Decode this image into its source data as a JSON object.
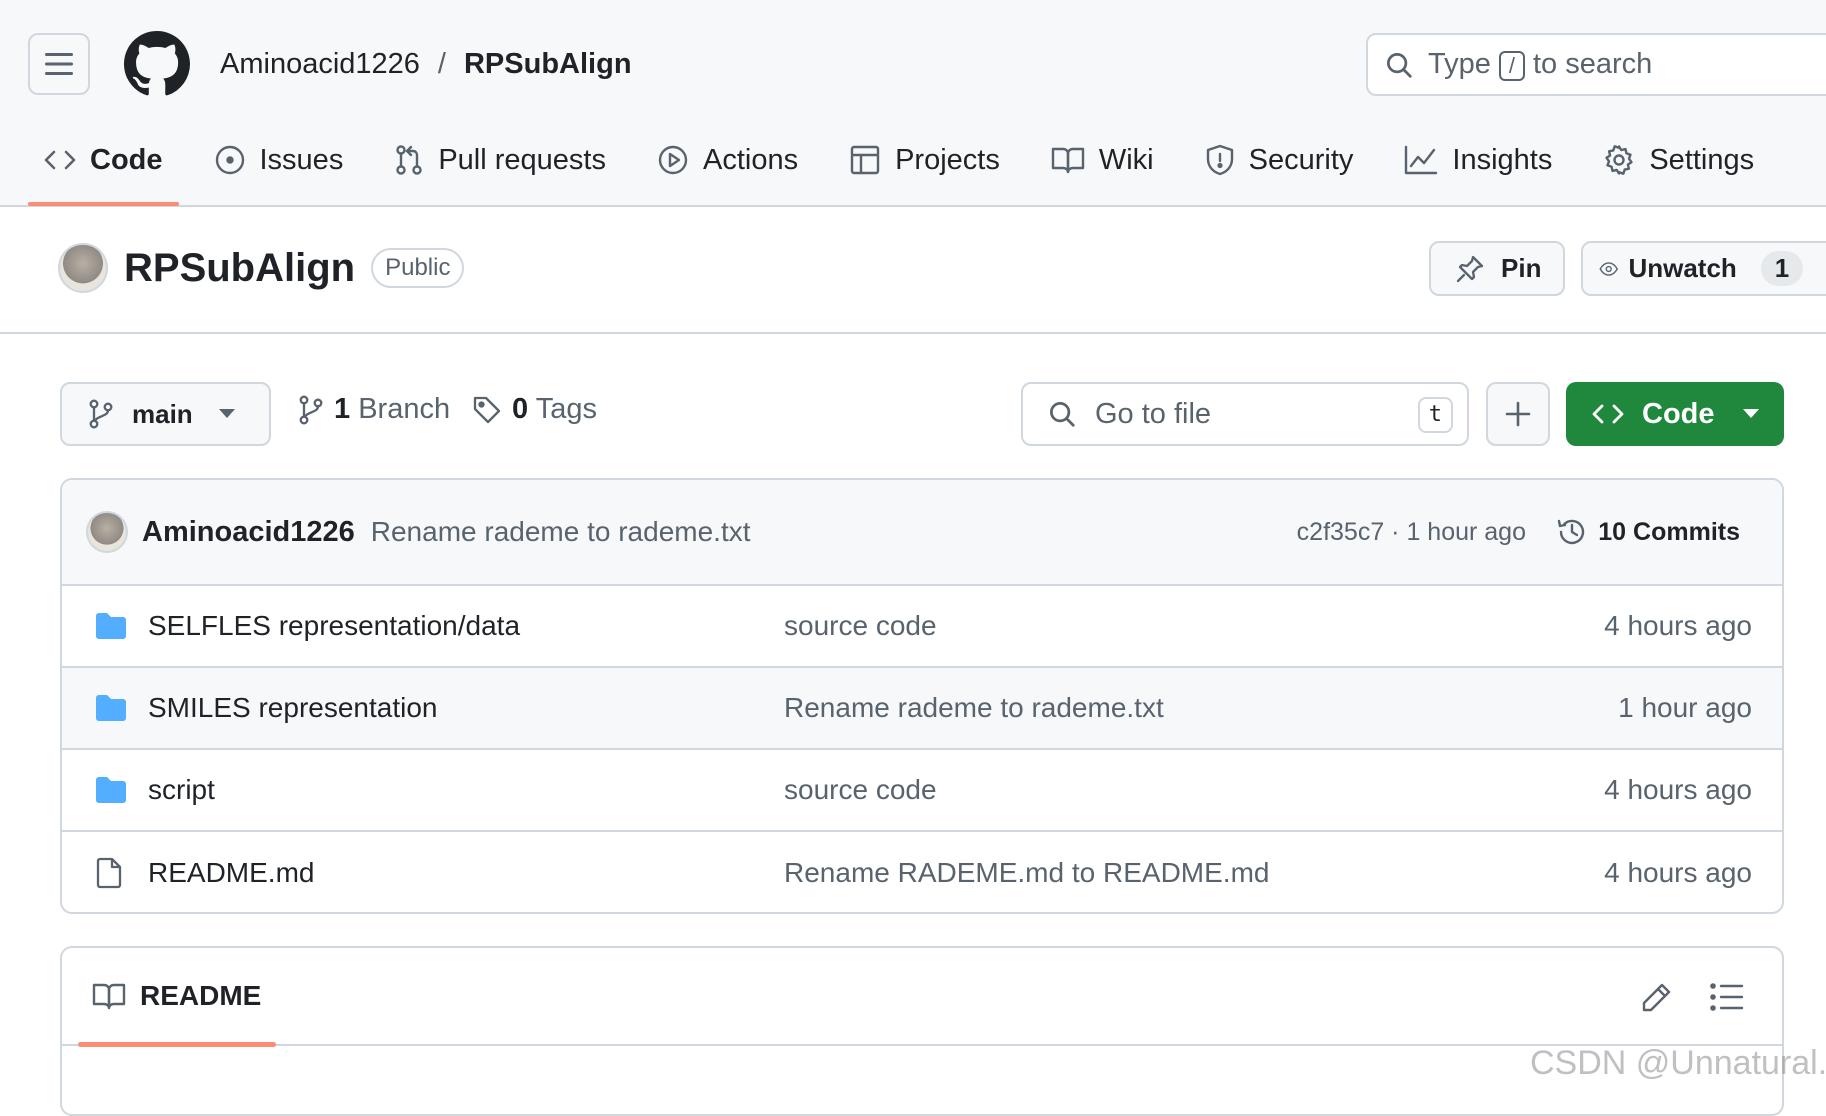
{
  "header": {
    "owner": "Aminoacid1226",
    "separator": "/",
    "repo": "RPSubAlign",
    "search": {
      "prefix": "Type",
      "key": "/",
      "suffix": "to search"
    }
  },
  "tabs": [
    {
      "label": "Code",
      "icon": "code-icon",
      "active": true
    },
    {
      "label": "Issues",
      "icon": "issue-opened-icon"
    },
    {
      "label": "Pull requests",
      "icon": "git-pull-request-icon"
    },
    {
      "label": "Actions",
      "icon": "play-icon"
    },
    {
      "label": "Projects",
      "icon": "table-icon"
    },
    {
      "label": "Wiki",
      "icon": "book-icon"
    },
    {
      "label": "Security",
      "icon": "shield-icon"
    },
    {
      "label": "Insights",
      "icon": "graph-icon"
    },
    {
      "label": "Settings",
      "icon": "gear-icon"
    }
  ],
  "repo_header": {
    "name": "RPSubAlign",
    "visibility": "Public",
    "pin_label": "Pin",
    "watch_label": "Unwatch",
    "watch_count": "1"
  },
  "toolbar": {
    "branch": "main",
    "branch_count": "1",
    "branch_label": "Branch",
    "tag_count": "0",
    "tag_label": "Tags",
    "go_to_file": "Go to file",
    "go_to_file_key": "t",
    "code_label": "Code"
  },
  "latest_commit": {
    "author": "Aminoacid1226",
    "message": "Rename rademe to rademe.txt",
    "hash_time": "c2f35c7 · 1 hour ago",
    "commit_count": "10 Commits"
  },
  "files": [
    {
      "type": "folder",
      "name": "SELFLES representation/data",
      "message": "source code",
      "time": "4 hours ago"
    },
    {
      "type": "folder",
      "name": "SMILES representation",
      "message": "Rename rademe to rademe.txt",
      "time": "1 hour ago"
    },
    {
      "type": "folder",
      "name": "script",
      "message": "source code",
      "time": "4 hours ago"
    },
    {
      "type": "file",
      "name": "README.md",
      "message": "Rename RADEME.md to README.md",
      "time": "4 hours ago"
    }
  ],
  "readme": {
    "title": "README"
  },
  "watermark": "CSDN @Unnatural.",
  "colors": {
    "accent": "#fd8c73",
    "primary_button": "#1f883d",
    "folder": "#54aeff",
    "border": "#d0d7de",
    "muted": "#59636e"
  }
}
